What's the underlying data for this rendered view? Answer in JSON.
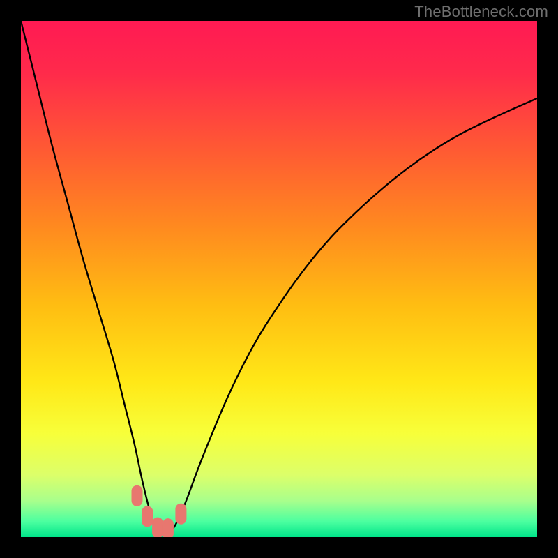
{
  "watermark": "TheBottleneck.com",
  "colors": {
    "frame": "#000000",
    "gradient_stops": [
      {
        "pos": 0.0,
        "color": "#ff1a53"
      },
      {
        "pos": 0.1,
        "color": "#ff2a4b"
      },
      {
        "pos": 0.25,
        "color": "#ff5a33"
      },
      {
        "pos": 0.4,
        "color": "#ff8a1f"
      },
      {
        "pos": 0.55,
        "color": "#ffbd12"
      },
      {
        "pos": 0.7,
        "color": "#ffe817"
      },
      {
        "pos": 0.8,
        "color": "#f7ff3a"
      },
      {
        "pos": 0.88,
        "color": "#dcff6a"
      },
      {
        "pos": 0.93,
        "color": "#a8ff8c"
      },
      {
        "pos": 0.97,
        "color": "#4bffa0"
      },
      {
        "pos": 1.0,
        "color": "#00e58a"
      }
    ],
    "marker": "#e8776f",
    "curve": "#000000"
  },
  "chart_data": {
    "type": "line",
    "title": "",
    "xlabel": "",
    "ylabel": "",
    "xlim": [
      0,
      100
    ],
    "ylim": [
      0,
      100
    ],
    "annotations": [],
    "series": [
      {
        "name": "bottleneck-curve",
        "x": [
          0,
          3,
          6,
          9,
          12,
          15,
          18,
          20,
          22,
          23.5,
          25,
          26,
          27,
          28,
          29,
          30,
          32,
          35,
          40,
          45,
          50,
          55,
          60,
          65,
          70,
          75,
          80,
          85,
          90,
          95,
          100
        ],
        "y": [
          100,
          88,
          76,
          65,
          54,
          44,
          34,
          26,
          18,
          11,
          5,
          2.3,
          1.1,
          1.0,
          1.3,
          2.5,
          7,
          15,
          27,
          37,
          45,
          52,
          58,
          63,
          67.5,
          71.5,
          75,
          78,
          80.5,
          82.8,
          85
        ]
      }
    ],
    "markers": [
      {
        "x": 22.5,
        "y": 8.0
      },
      {
        "x": 24.5,
        "y": 4.0
      },
      {
        "x": 26.5,
        "y": 1.8
      },
      {
        "x": 28.5,
        "y": 1.6
      },
      {
        "x": 31.0,
        "y": 4.5
      }
    ]
  }
}
